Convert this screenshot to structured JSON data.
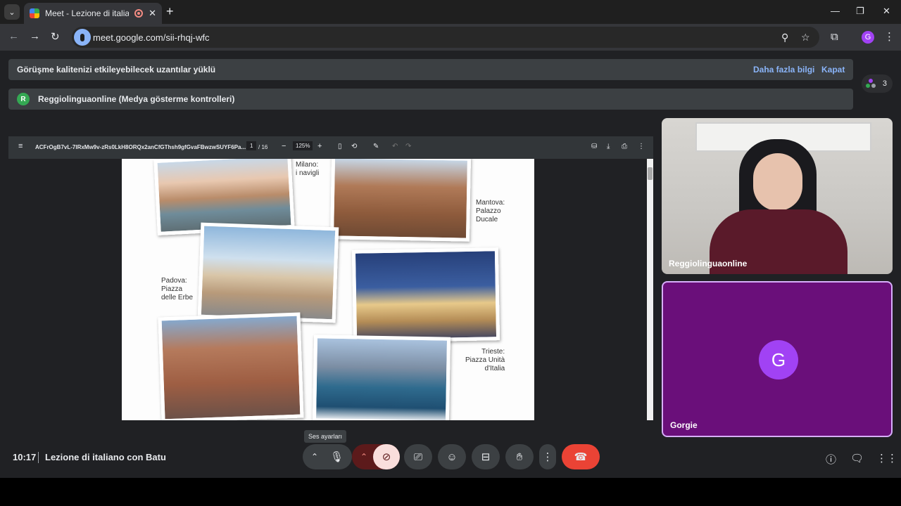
{
  "browser": {
    "tab_title": "Meet - Lezione di italiano c",
    "url": "meet.google.com/sii-rhqj-wfc",
    "profile_initial": "G"
  },
  "banners": {
    "extensions_text": "Görüşme kalitenizi etkileyebilecek uzantılar yüklü",
    "learn_more": "Daha fazla bilgi",
    "close": "Kapat",
    "presenter_initial": "R",
    "presenter_text": "Reggiolinguaonline (Medya gösterme kontrolleri)"
  },
  "participants_count": "3",
  "pdf": {
    "filename": "ACFrOgB7vL-7IRxMw9v-zRs0LkH8ORQx2anCfGThsh9gfGvaFBwzwSUYF6Pa...",
    "page_current": "1",
    "page_total": "/ 16",
    "zoom": "125%",
    "captions": {
      "milano": [
        "Milano:",
        "i navigli"
      ],
      "mantova": [
        "Mantova:",
        "Palazzo",
        "Ducale"
      ],
      "padova": [
        "Padova:",
        "Piazza",
        "delle Erbe"
      ],
      "trieste": [
        "Trieste:",
        "Piazza Unità",
        "d'Italia"
      ]
    }
  },
  "tiles": {
    "presenter_name": "Reggiolinguaonline",
    "self_name": "Gorgie",
    "self_initial": "G"
  },
  "bottom_bar": {
    "time": "10:17",
    "meeting_title": "Lezione di italiano con Batu",
    "tooltip": "Ses ayarları"
  },
  "colors": {
    "end_call": "#ea4335",
    "camera_off": "#f9dedc",
    "self_tile": "#6a0f7a",
    "avatar": "#a142f4"
  }
}
